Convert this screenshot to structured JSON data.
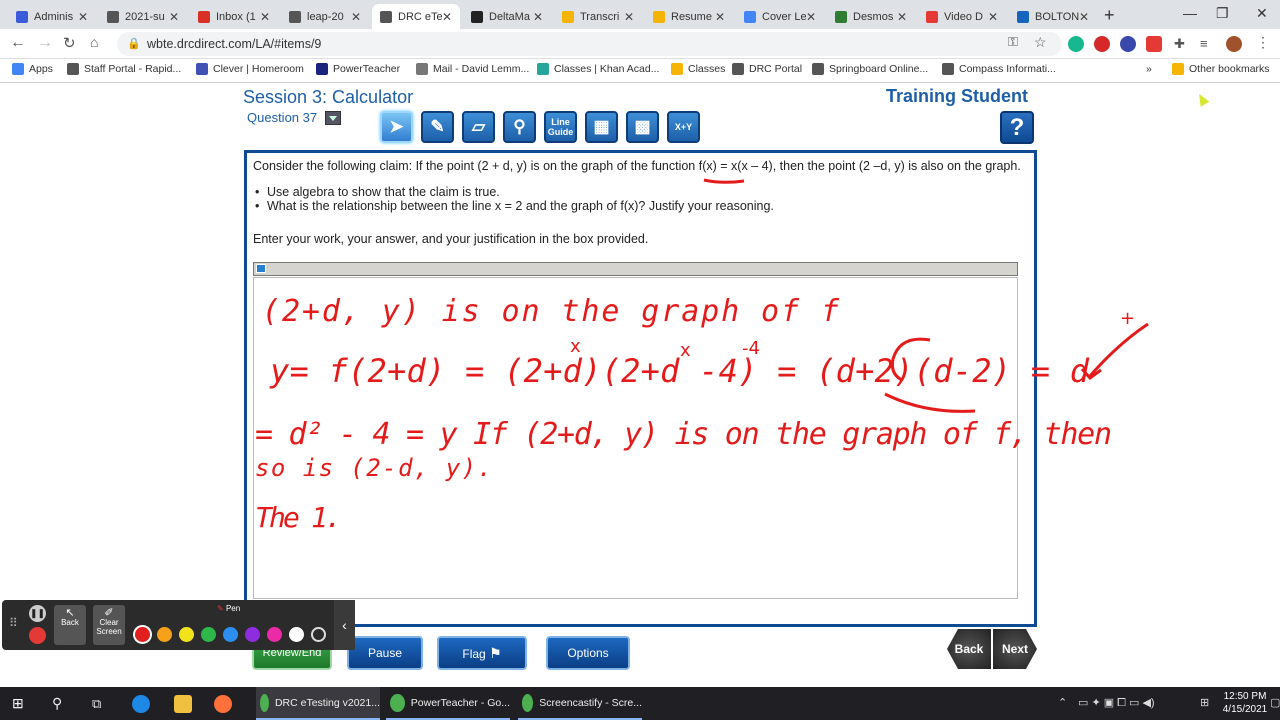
{
  "browser": {
    "tabs": [
      {
        "title": "Adminis",
        "color": "#3a5cd8"
      },
      {
        "title": "2021-su",
        "color": "#555"
      },
      {
        "title": "Inbox (1",
        "color": "#d93025"
      },
      {
        "title": "leap-20",
        "color": "#555"
      },
      {
        "title": "DRC eTe",
        "color": "#555",
        "active": true
      },
      {
        "title": "DeltaMa",
        "color": "#222"
      },
      {
        "title": "Transcri",
        "color": "#f4b400"
      },
      {
        "title": "Resume",
        "color": "#f4b400"
      },
      {
        "title": "Cover Le",
        "color": "#4285f4"
      },
      {
        "title": "Desmos",
        "color": "#2e7d32"
      },
      {
        "title": "Video D",
        "color": "#e53935"
      },
      {
        "title": "BOLTON",
        "color": "#1565c0"
      }
    ],
    "url": "wbte.drcdirect.com/LA/#items/9",
    "bookmarks": [
      "Apps",
      "Staff Portal - Rapid...",
      "Clever | Homeroom",
      "PowerTeacher",
      "Mail - David Lemm...",
      "Classes | Khan Acad...",
      "Classes",
      "DRC Portal",
      "Springboard Online...",
      "Compass Informati...",
      "Other bookmarks"
    ]
  },
  "header": {
    "session_title": "Session 3: Calculator",
    "question_label": "Question 37",
    "student_name": "Training Student"
  },
  "toolbar": {
    "tools": [
      {
        "name": "pointer-tool",
        "label": "",
        "glyph": "➤"
      },
      {
        "name": "highlighter-tool",
        "label": "",
        "glyph": "✎"
      },
      {
        "name": "sticky-note-tool",
        "label": "",
        "glyph": "▱"
      },
      {
        "name": "magnifier-tool",
        "label": "",
        "glyph": "⚲"
      },
      {
        "name": "line-guide-tool",
        "label": "Line Guide",
        "glyph": ""
      },
      {
        "name": "calculator-tool",
        "label": "",
        "glyph": "▦"
      },
      {
        "name": "graph-paper-tool",
        "label": "",
        "glyph": "▩"
      },
      {
        "name": "equation-tool",
        "label": "X+Y",
        "glyph": ""
      }
    ],
    "help_label": "?"
  },
  "question": {
    "claim": "Consider the following claim: If the point (2 + d, y) is on the graph of the function f(x) = x(x – 4), then the point (2 –d, y) is also on the graph.",
    "bullets": [
      "Use algebra to show that the claim is true.",
      "What is the relationship between the line x = 2 and the graph of f(x)? Justify your reasoning."
    ],
    "instruction": "Enter your work, your answer, and your justification in the box provided."
  },
  "handwriting": {
    "color": "#e41b1b",
    "lines": [
      "(2+d, y) is on the graph of f",
      "y= f(2+d) = (2+d)(2+d -4) = (d+2)(d-2) = d",
      "= d² - 4 = y   If (2+d, y) is on the graph of f, then",
      "so is (2-d, y).",
      "The 1."
    ],
    "notes": [
      "x",
      "x",
      "-4",
      "+"
    ]
  },
  "nav": {
    "review": "Review/End Test",
    "pause": "Pause",
    "flag": "Flag",
    "options": "Options",
    "back": "Back",
    "next": "Next"
  },
  "castify": {
    "back": "Back",
    "clear": "Clear Screen",
    "pen": "Pen",
    "colors": [
      "#e31e1e",
      "#f5a21a",
      "#f1e21b",
      "#2fb84a",
      "#2d8ef0",
      "#8e2de0",
      "#ea2aa6",
      "#ffffff",
      "#2b2b2b"
    ]
  },
  "taskbar": {
    "apps": [
      "DRC eTesting v2021...",
      "PowerTeacher - Go...",
      "Screencastify - Scre..."
    ],
    "time": "12:50 PM",
    "date": "4/15/2021"
  }
}
